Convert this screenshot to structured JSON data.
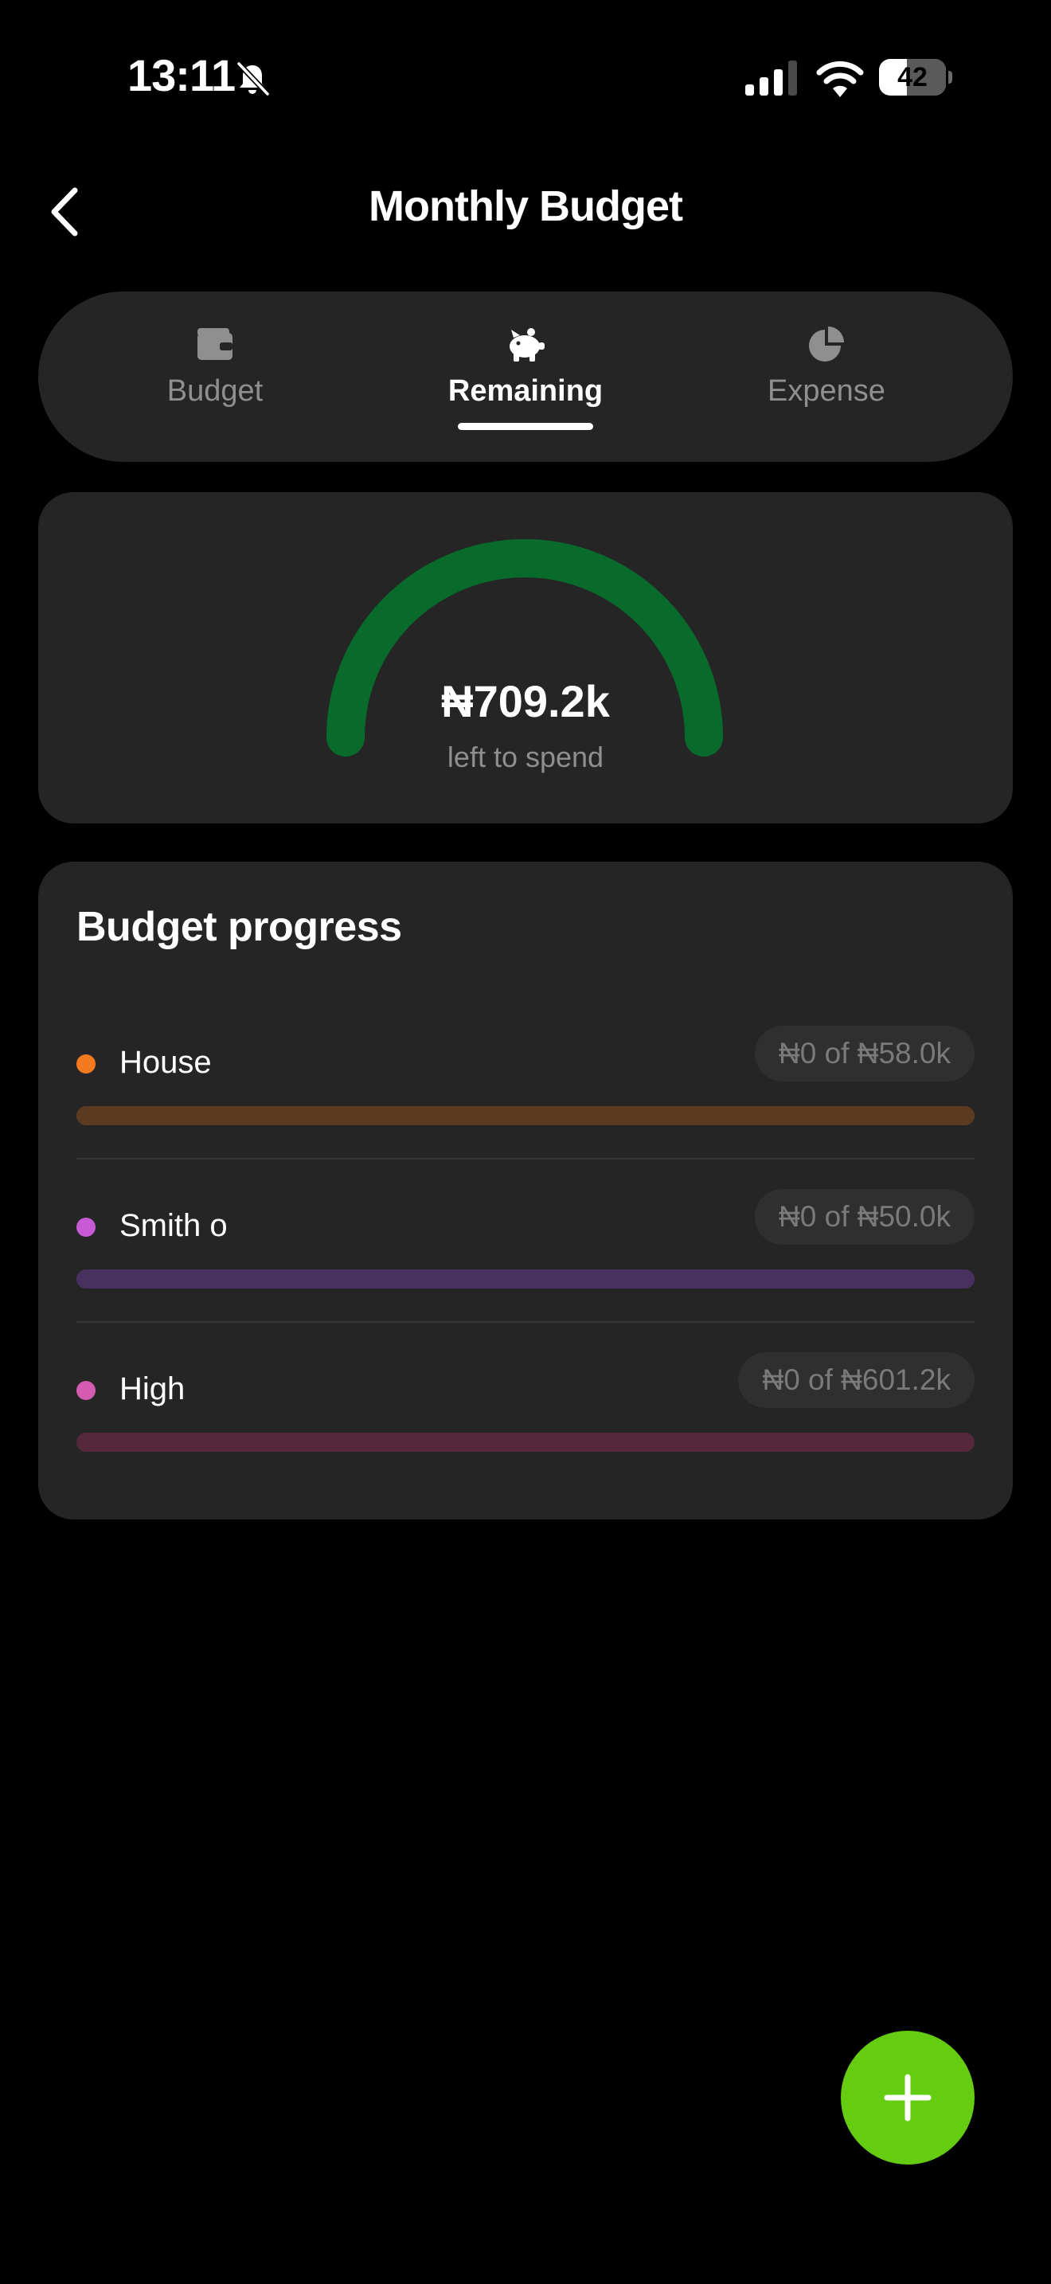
{
  "status_bar": {
    "time": "13:11",
    "battery": "42",
    "battery_level": 0.42,
    "icons": [
      "bell-slash-icon",
      "signal-icon",
      "wifi-icon",
      "battery-icon"
    ]
  },
  "header": {
    "title": "Monthly Budget",
    "back_icon": "chevron-left-icon"
  },
  "tabs": [
    {
      "label": "Budget",
      "icon": "wallet-icon",
      "active": false
    },
    {
      "label": "Remaining",
      "icon": "piggy-bank-icon",
      "active": true
    },
    {
      "label": "Expense",
      "icon": "pie-chart-icon",
      "active": false
    }
  ],
  "gauge": {
    "amount": "₦709.2k",
    "caption": "left to spend",
    "fraction": 1.0,
    "color": "#086b2c"
  },
  "progress": {
    "title": "Budget progress",
    "items": [
      {
        "name": "House",
        "amount": "₦0 of ₦58.0k",
        "spent_fraction": 0,
        "dot_color": "#f57a1f",
        "track_color": "#5c3a21"
      },
      {
        "name": "Smith o",
        "amount": "₦0 of ₦50.0k",
        "spent_fraction": 0,
        "dot_color": "#c85ad6",
        "track_color": "#47325f"
      },
      {
        "name": "High",
        "amount": "₦0 of ₦601.2k",
        "spent_fraction": 0,
        "dot_color": "#d55bb0",
        "track_color": "#55293b"
      }
    ]
  },
  "fab": {
    "icon": "plus-icon",
    "color": "#66cc11"
  }
}
